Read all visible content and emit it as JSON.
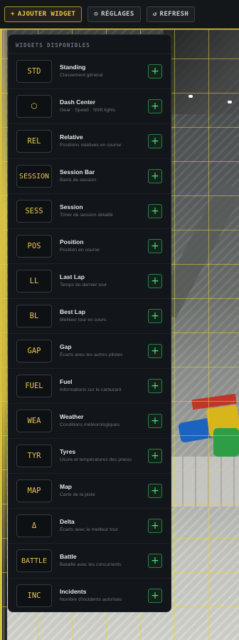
{
  "toolbar": {
    "add_widget": {
      "icon": "+",
      "label": "AJOUTER WIDGET"
    },
    "settings": {
      "icon": "⚙",
      "label": "RÉGLAGES"
    },
    "refresh": {
      "icon": "↺",
      "label": "REFRESH"
    }
  },
  "panel": {
    "title": "WIDGETS DISPONIBLES",
    "add_symbol": "+",
    "widgets": [
      {
        "badge": "STD",
        "name": "Standing",
        "desc": "Classement général"
      },
      {
        "badge": "⬡",
        "name": "Dash Center",
        "desc": "Gear · Speed · Shift lights"
      },
      {
        "badge": "REL",
        "name": "Relative",
        "desc": "Positions relatives en course"
      },
      {
        "badge": "SESSION",
        "name": "Session Bar",
        "desc": "Barre de session"
      },
      {
        "badge": "SESS",
        "name": "Session",
        "desc": "Timer de session détaillé"
      },
      {
        "badge": "POS",
        "name": "Position",
        "desc": "Position en course"
      },
      {
        "badge": "LL",
        "name": "Last Lap",
        "desc": "Temps du dernier tour"
      },
      {
        "badge": "BL",
        "name": "Best Lap",
        "desc": "Meilleur tour en cours"
      },
      {
        "badge": "GAP",
        "name": "Gap",
        "desc": "Écarts avec les autres pilotes"
      },
      {
        "badge": "FUEL",
        "name": "Fuel",
        "desc": "Informations sur le carburant"
      },
      {
        "badge": "WEA",
        "name": "Weather",
        "desc": "Conditions météorologiques"
      },
      {
        "badge": "TYR",
        "name": "Tyres",
        "desc": "Usure et températures des pneus"
      },
      {
        "badge": "MAP",
        "name": "Map",
        "desc": "Carte de la piste"
      },
      {
        "badge": "Δ",
        "name": "Delta",
        "desc": "Écarts avec le meilleur tour"
      },
      {
        "badge": "BATTLE",
        "name": "Battle",
        "desc": "Bataille avec les concurrents"
      },
      {
        "badge": "INC",
        "name": "Incidents",
        "desc": "Nombre d'incidents autorisés"
      }
    ]
  },
  "colors": {
    "accent": "#e8c44e",
    "add": "#56d88a",
    "panel_bg": "#121519"
  }
}
